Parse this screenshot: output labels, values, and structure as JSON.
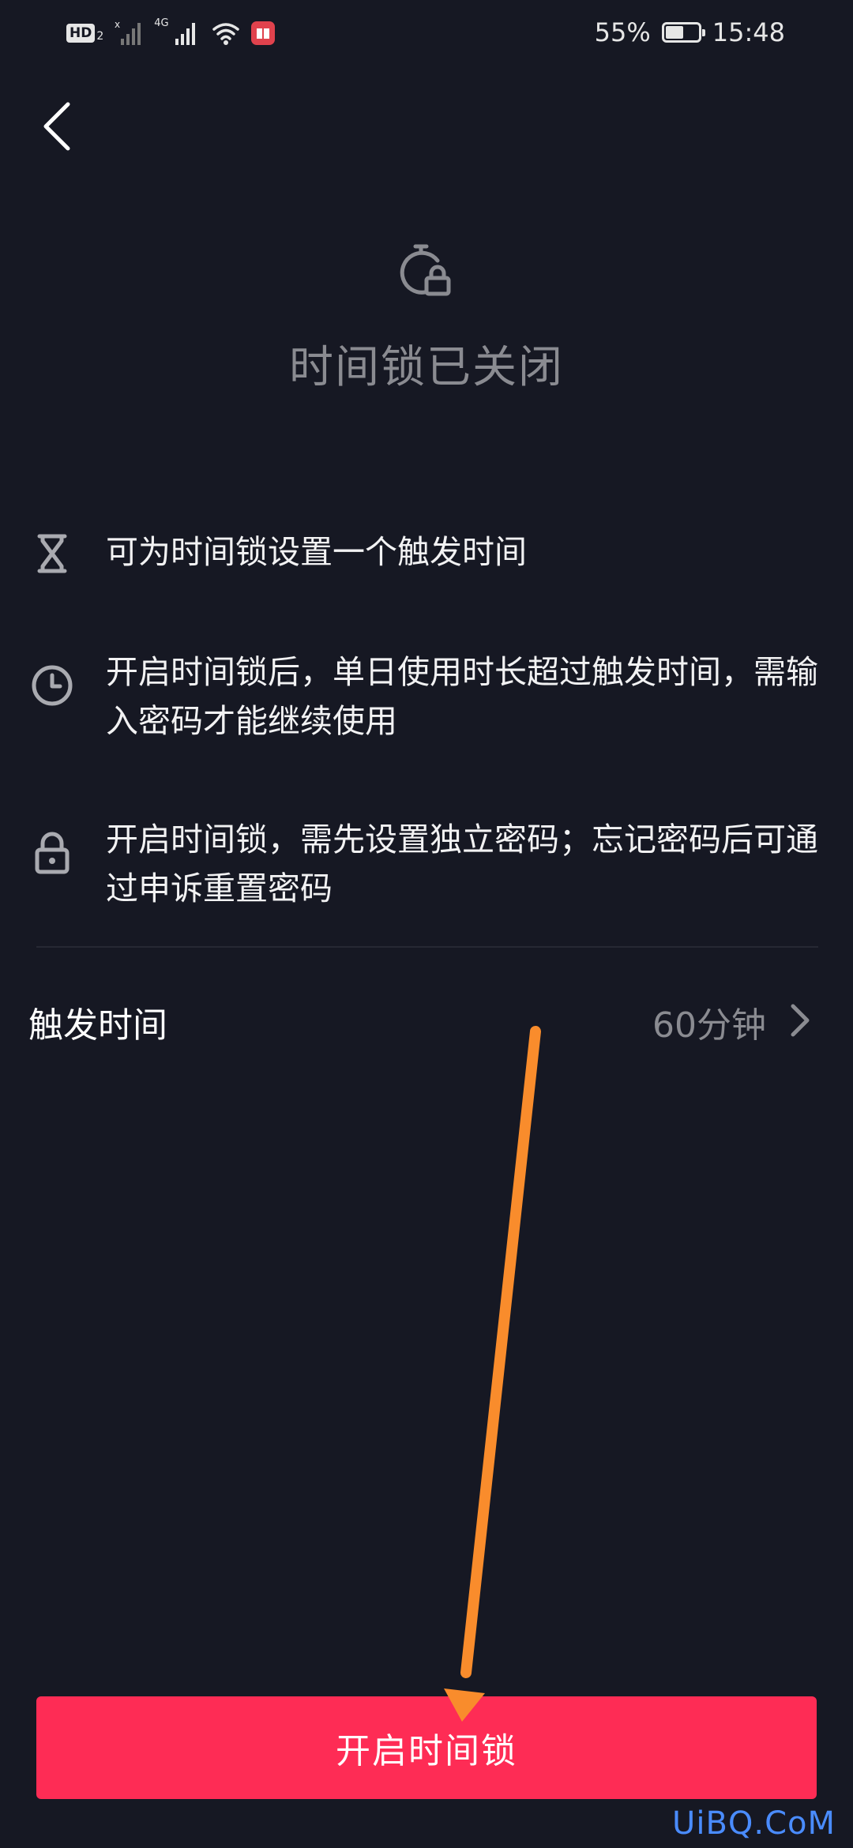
{
  "status_bar": {
    "hd_badge": "HD",
    "hd_sub": "2",
    "network_label": "4G",
    "battery_percent_text": "55%",
    "battery_level": 0.55,
    "time": "15:48"
  },
  "page": {
    "status_title": "时间锁已关闭"
  },
  "features": [
    {
      "icon": "hourglass-icon",
      "text": "可为时间锁设置一个触发时间"
    },
    {
      "icon": "clock-icon",
      "text": "开启时间锁后，单日使用时长超过触发时间，需输入密码才能继续使用"
    },
    {
      "icon": "lock-icon",
      "text": "开启时间锁，需先设置独立密码；忘记密码后可通过申诉重置密码"
    }
  ],
  "trigger": {
    "label": "触发时间",
    "value": "60分钟"
  },
  "primary_button": {
    "label": "开启时间锁"
  },
  "annotation": {
    "arrow_color": "#f98c2c"
  },
  "watermark": "UiBQ.CoM",
  "colors": {
    "background": "#161823",
    "accent": "#fe2c55",
    "muted_text": "#8a8b91"
  }
}
